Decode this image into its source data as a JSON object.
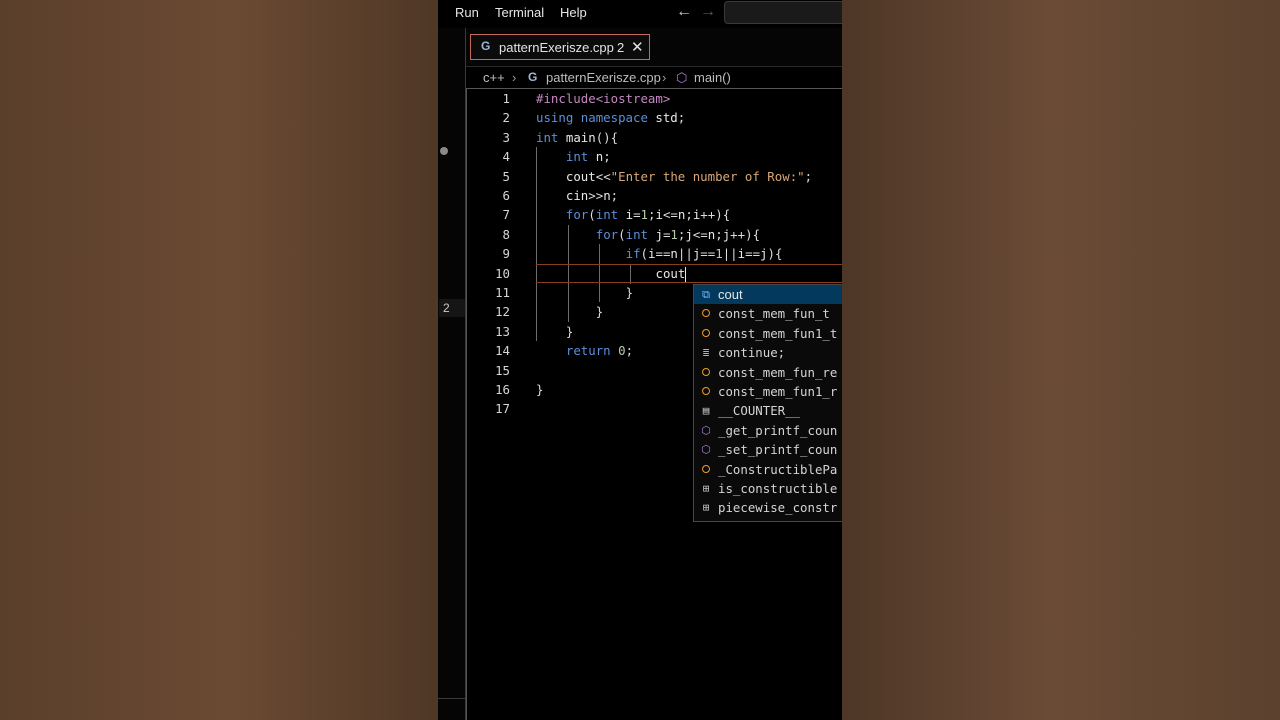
{
  "menubar": {
    "items": [
      "Run",
      "Terminal",
      "Help"
    ],
    "back_icon": "arrow-left-icon",
    "forward_icon": "arrow-right-icon"
  },
  "tab": {
    "label": "patternExerisze.cpp",
    "problems": "2",
    "close_icon": "close-icon"
  },
  "breadcrumb": {
    "folder": "c++",
    "file": "patternExerisze.cpp",
    "symbol": "main()"
  },
  "gutter": {
    "problem_badge": "2"
  },
  "editor": {
    "active_line": 10,
    "lines": [
      {
        "n": "1",
        "text": "#include<iostream>"
      },
      {
        "n": "2",
        "text": "using namespace std;"
      },
      {
        "n": "3",
        "text": "int main(){"
      },
      {
        "n": "4",
        "text": "    int n;"
      },
      {
        "n": "5",
        "text": "    cout<<\"Enter the number of Row:\";"
      },
      {
        "n": "6",
        "text": "    cin>>n;"
      },
      {
        "n": "7",
        "text": "    for(int i=1;i<=n;i++){"
      },
      {
        "n": "8",
        "text": "        for(int j=1;j<=n;j++){"
      },
      {
        "n": "9",
        "text": "            if(i==n||j==1||i==j){"
      },
      {
        "n": "10",
        "text": "                cout"
      },
      {
        "n": "11",
        "text": "            }"
      },
      {
        "n": "12",
        "text": "        }"
      },
      {
        "n": "13",
        "text": "    }"
      },
      {
        "n": "14",
        "text": "    return 0;"
      },
      {
        "n": "15",
        "text": ""
      },
      {
        "n": "16",
        "text": "}"
      },
      {
        "n": "17",
        "text": ""
      }
    ]
  },
  "suggestions": [
    {
      "label": "cout",
      "icon": "variable-icon"
    },
    {
      "label": "const_mem_fun_t",
      "icon": "class-icon"
    },
    {
      "label": "const_mem_fun1_t",
      "icon": "class-icon"
    },
    {
      "label": "continue;",
      "icon": "snippet-icon"
    },
    {
      "label": "const_mem_fun_re",
      "icon": "class-icon"
    },
    {
      "label": "const_mem_fun1_r",
      "icon": "class-icon"
    },
    {
      "label": "__COUNTER__",
      "icon": "constant-icon"
    },
    {
      "label": "_get_printf_coun",
      "icon": "method-icon"
    },
    {
      "label": "_set_printf_coun",
      "icon": "method-icon"
    },
    {
      "label": "_ConstructiblePa",
      "icon": "class-icon"
    },
    {
      "label": "is_constructible",
      "icon": "struct-icon"
    },
    {
      "label": "piecewise_constr",
      "icon": "struct-icon"
    }
  ]
}
